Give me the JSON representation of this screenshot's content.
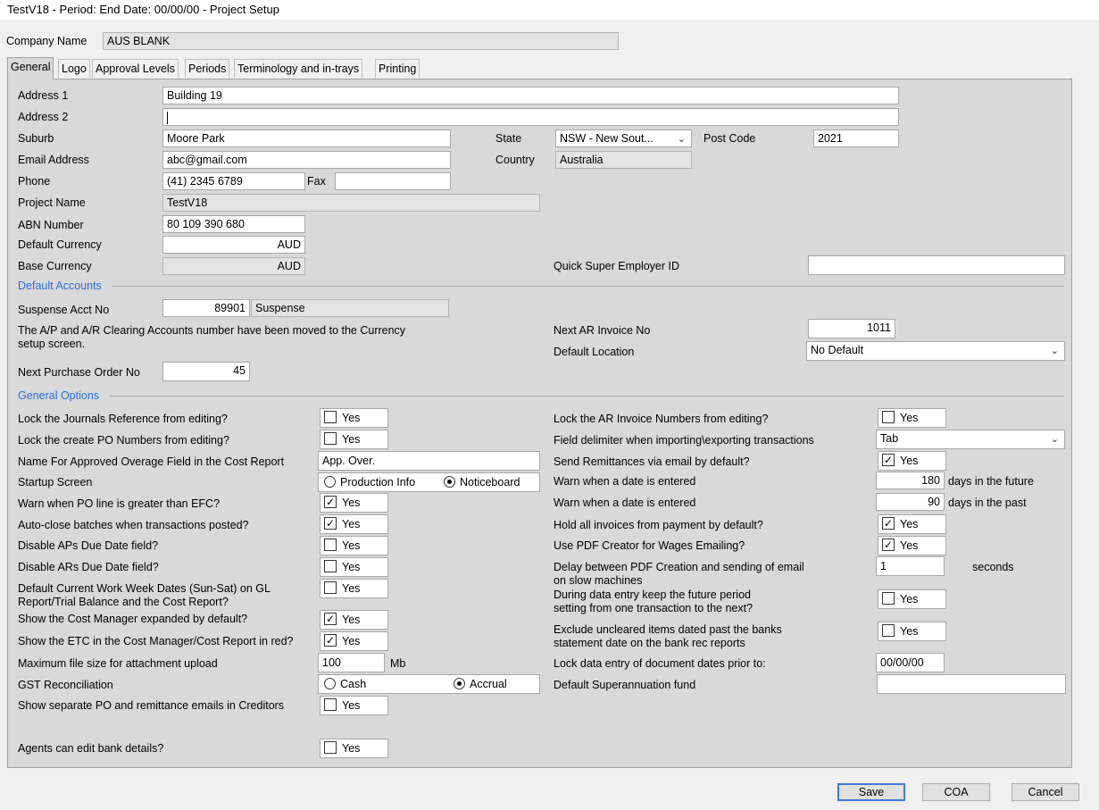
{
  "window": {
    "title": "TestV18  - Period:  End Date: 00/00/00 - Project Setup"
  },
  "company": {
    "label": "Company Name",
    "value": "AUS BLANK"
  },
  "tabs": [
    "General",
    "Logo",
    "Approval Levels",
    "Periods",
    "Terminology and in-trays",
    "Printing"
  ],
  "address": {
    "address1_label": "Address 1",
    "address1": "Building 19",
    "address2_label": "Address 2",
    "address2": "",
    "suburb_label": "Suburb",
    "suburb": "Moore Park",
    "state_label": "State",
    "state": "NSW - New Sout...",
    "postcode_label": "Post Code",
    "postcode": "2021",
    "email_label": "Email Address",
    "email": "abc@gmail.com",
    "country_label": "Country",
    "country": "Australia",
    "phone_label": "Phone",
    "phone": "(41) 2345 6789",
    "fax_label": "Fax",
    "fax": "",
    "project_label": "Project Name",
    "project": "TestV18",
    "abn_label": "ABN Number",
    "abn": "80 109 390 680",
    "default_currency_label": "Default Currency",
    "default_currency": "AUD",
    "base_currency_label": "Base Currency",
    "base_currency": "AUD",
    "quick_super_label": "Quick Super Employer ID",
    "quick_super": ""
  },
  "default_accounts": {
    "section": "Default Accounts",
    "suspense_label": "Suspense Acct No",
    "suspense_no": "89901",
    "suspense_name": "Suspense",
    "note_line1": "The A/P and A/R Clearing Accounts number have been moved to the Currency",
    "note_line2": "setup screen.",
    "next_ar_label": "Next AR Invoice No",
    "next_ar": "1011",
    "default_location_label": "Default Location",
    "default_location": "No Default",
    "next_po_label": "Next Purchase Order No",
    "next_po": "45"
  },
  "general_options": {
    "section": "General Options",
    "yes": "Yes",
    "lock_journals": "Lock the Journals Reference from editing?",
    "lock_po": "Lock the create PO Numbers from editing?",
    "overage_name_label": "Name For Approved Overage Field in the Cost Report",
    "overage_name": "App. Over.",
    "startup_label": "Startup Screen",
    "startup_opt1": "Production Info",
    "startup_opt2": "Noticeboard",
    "warn_po": "Warn when PO line is greater than EFC?",
    "auto_close": "Auto-close batches when transactions posted?",
    "disable_ap": "Disable APs Due Date field?",
    "disable_ar": "Disable ARs Due Date field?",
    "default_week_1": "Default Current Work Week Dates (Sun-Sat) on GL",
    "default_week_2": "Report/Trial Balance and the Cost Report?",
    "cost_manager": "Show the Cost Manager expanded by default?",
    "etc_red": "Show the ETC in the Cost Manager/Cost Report in red?",
    "max_file_label": "Maximum file size for attachment upload",
    "max_file": "100",
    "max_file_unit": "Mb",
    "gst_label": "GST Reconciliation",
    "gst_opt1": "Cash",
    "gst_opt2": "Accrual",
    "separate_po": "Show separate PO and remittance emails in Creditors",
    "agents_bank": "Agents can edit bank details?",
    "lock_ar": "Lock the AR Invoice Numbers from editing?",
    "delimiter_label": "Field delimiter when importing\\exporting transactions",
    "delimiter": "Tab",
    "send_remit": "Send Remittances via email by default?",
    "warn_future_label": "Warn when a date is entered",
    "warn_future": "180",
    "warn_future_unit": "days in the future",
    "warn_past_label": "Warn when a date is entered",
    "warn_past": "90",
    "warn_past_unit": "days in the past",
    "hold_invoices": "Hold all invoices from payment by default?",
    "pdf_creator": "Use PDF Creator for Wages Emailing?",
    "delay_1": "Delay between PDF Creation and sending of email",
    "delay_2": "on slow machines",
    "delay": "1",
    "delay_unit": "seconds",
    "future_period_1": "During data entry keep the future period",
    "future_period_2": "setting from one transaction to the next?",
    "exclude_1": "Exclude uncleared items dated past the banks",
    "exclude_2": "statement date on the bank rec reports",
    "lock_dates_label": "Lock data entry of document dates prior to:",
    "lock_dates": "00/00/00",
    "super_fund_label": "Default Superannuation fund",
    "super_fund": ""
  },
  "buttons": {
    "save": "Save",
    "coa": "COA",
    "cancel": "Cancel"
  }
}
